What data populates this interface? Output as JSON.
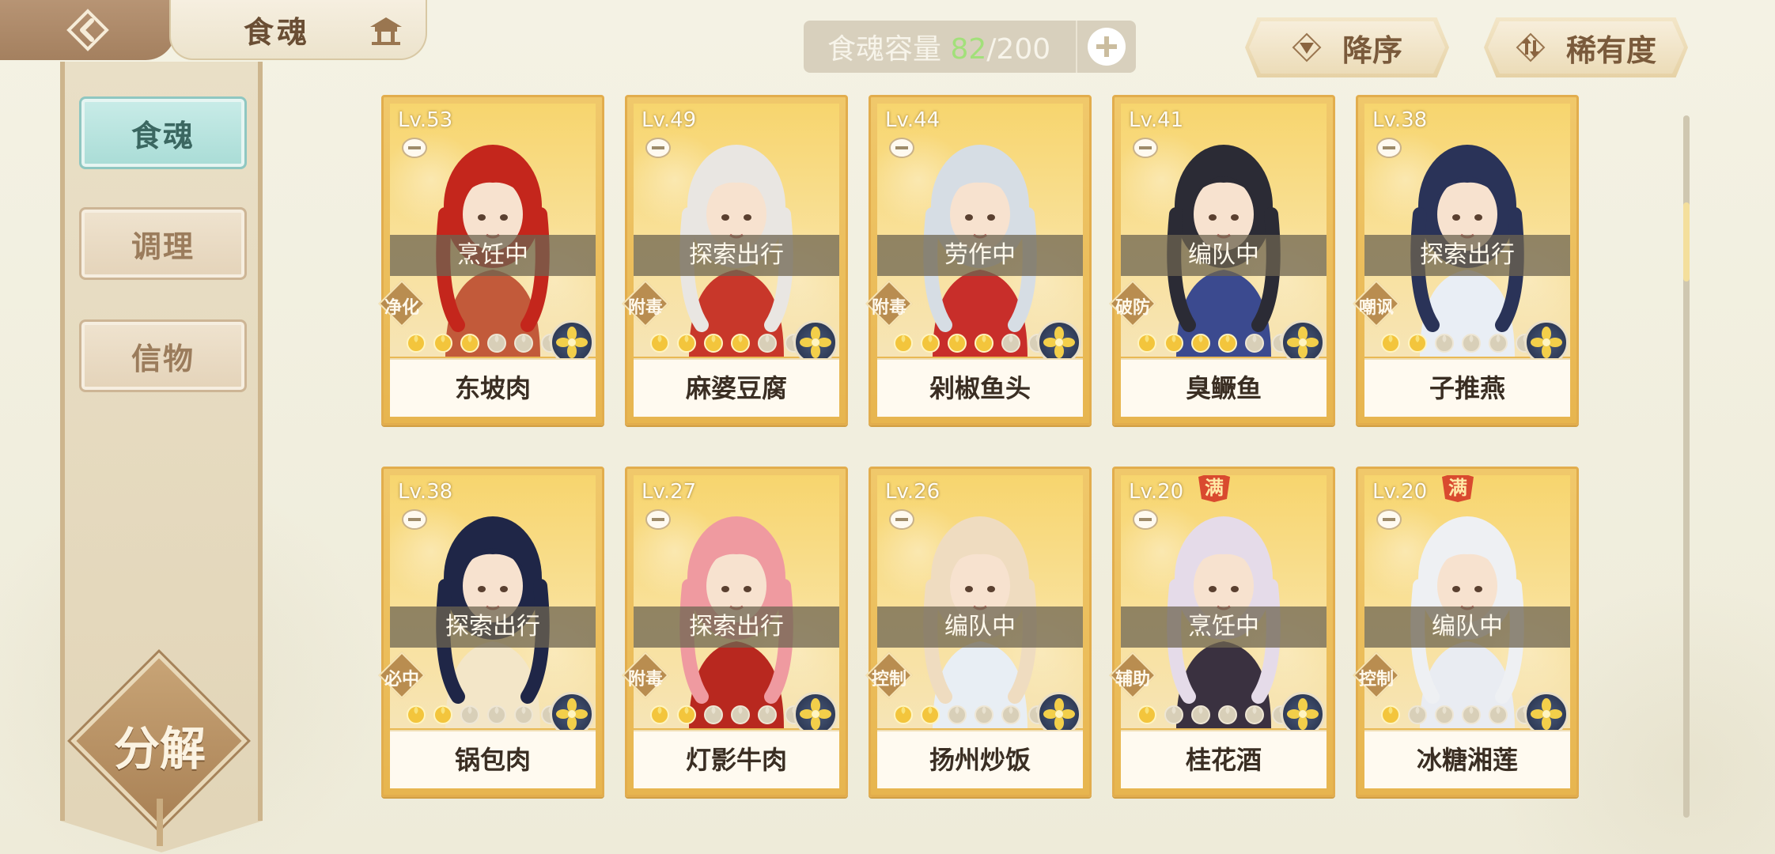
{
  "header": {
    "title": "食魂",
    "back_icon": "back-arrow-icon",
    "home_icon": "pavilion-icon"
  },
  "sidebar": {
    "tabs": [
      {
        "label": "食魂",
        "active": true
      },
      {
        "label": "调理",
        "active": false
      },
      {
        "label": "信物",
        "active": false
      }
    ],
    "decompose_label": "分解"
  },
  "capacity": {
    "label": "食魂容量",
    "current": "82",
    "separator_max": "/200",
    "add_icon": "plus-icon"
  },
  "sort": {
    "order_label": "降序",
    "rarity_label": "稀有度"
  },
  "colors": {
    "card_gold": "#e7b54f",
    "tab_active": "#a9dcd6",
    "capacity_current": "#a2e07a"
  },
  "cards": [
    {
      "level": "Lv.53",
      "status": "烹饪中",
      "role": "净化",
      "stars": 6,
      "stars_lit": 3,
      "name": "东坡肉",
      "full": false,
      "hair": "#c4261c",
      "outfit": "#c25a3a"
    },
    {
      "level": "Lv.49",
      "status": "探索出行",
      "role": "附毒",
      "stars": 6,
      "stars_lit": 4,
      "name": "麻婆豆腐",
      "full": false,
      "hair": "#e9e6e2",
      "outfit": "#c8372a"
    },
    {
      "level": "Lv.44",
      "status": "劳作中",
      "role": "附毒",
      "stars": 6,
      "stars_lit": 4,
      "name": "剁椒鱼头",
      "full": false,
      "hair": "#d6dde4",
      "outfit": "#c82e2a"
    },
    {
      "level": "Lv.41",
      "status": "编队中",
      "role": "破防",
      "stars": 6,
      "stars_lit": 4,
      "name": "臭鳜鱼",
      "full": false,
      "hair": "#2b2b35",
      "outfit": "#3b4a8f"
    },
    {
      "level": "Lv.38",
      "status": "探索出行",
      "role": "嘲讽",
      "stars": 6,
      "stars_lit": 2,
      "name": "子推燕",
      "full": false,
      "hair": "#2a3358",
      "outfit": "#e9eef5"
    },
    {
      "level": "Lv.38",
      "status": "探索出行",
      "role": "必中",
      "stars": 6,
      "stars_lit": 2,
      "name": "锅包肉",
      "full": false,
      "hair": "#1f2647",
      "outfit": "#f3e6c8"
    },
    {
      "level": "Lv.27",
      "status": "探索出行",
      "role": "附毒",
      "stars": 6,
      "stars_lit": 2,
      "name": "灯影牛肉",
      "full": false,
      "hair": "#ef9aa0",
      "outfit": "#b8281f"
    },
    {
      "level": "Lv.26",
      "status": "编队中",
      "role": "控制",
      "stars": 6,
      "stars_lit": 2,
      "name": "扬州炒饭",
      "full": false,
      "hair": "#efdcc0",
      "outfit": "#e8eef4"
    },
    {
      "level": "Lv.20",
      "status": "烹饪中",
      "role": "辅助",
      "stars": 6,
      "stars_lit": 1,
      "name": "桂花酒",
      "full": true,
      "full_label": "满",
      "hair": "#e5dbe9",
      "outfit": "#3a3140"
    },
    {
      "level": "Lv.20",
      "status": "编队中",
      "role": "控制",
      "stars": 6,
      "stars_lit": 1,
      "name": "冰糖湘莲",
      "full": true,
      "full_label": "满",
      "hair": "#eef0f3",
      "outfit": "#e9ecf2"
    }
  ]
}
